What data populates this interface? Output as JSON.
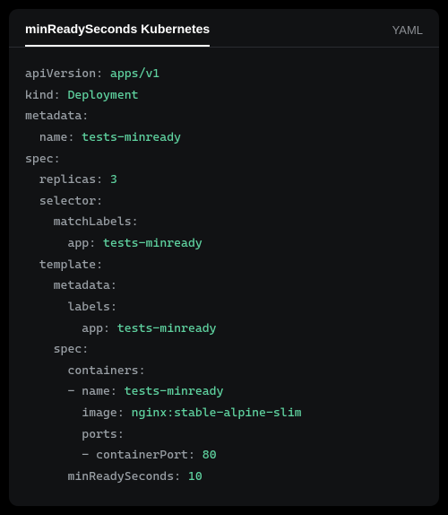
{
  "header": {
    "tab_label": "minReadySeconds Kubernetes",
    "language_label": "YAML"
  },
  "yaml": {
    "apiVersion_key": "apiVersion",
    "apiVersion_val": "apps/v1",
    "kind_key": "kind",
    "kind_val": "Deployment",
    "metadata_key": "metadata",
    "name_key": "name",
    "name_val": "tests-minready",
    "spec_key": "spec",
    "replicas_key": "replicas",
    "replicas_val": "3",
    "selector_key": "selector",
    "matchLabels_key": "matchLabels",
    "app_key": "app",
    "app_val": "tests-minready",
    "template_key": "template",
    "tmpl_metadata_key": "metadata",
    "labels_key": "labels",
    "tmpl_app_key": "app",
    "tmpl_app_val": "tests-minready",
    "tmpl_spec_key": "spec",
    "containers_key": "containers",
    "c_name_key": "name",
    "c_name_val": "tests-minready",
    "c_image_key": "image",
    "c_image_val": "nginx:stable-alpine-slim",
    "c_ports_key": "ports",
    "c_containerPort_key": "containerPort",
    "c_containerPort_val": "80",
    "minReadySeconds_key": "minReadySeconds",
    "minReadySeconds_val": "10"
  }
}
